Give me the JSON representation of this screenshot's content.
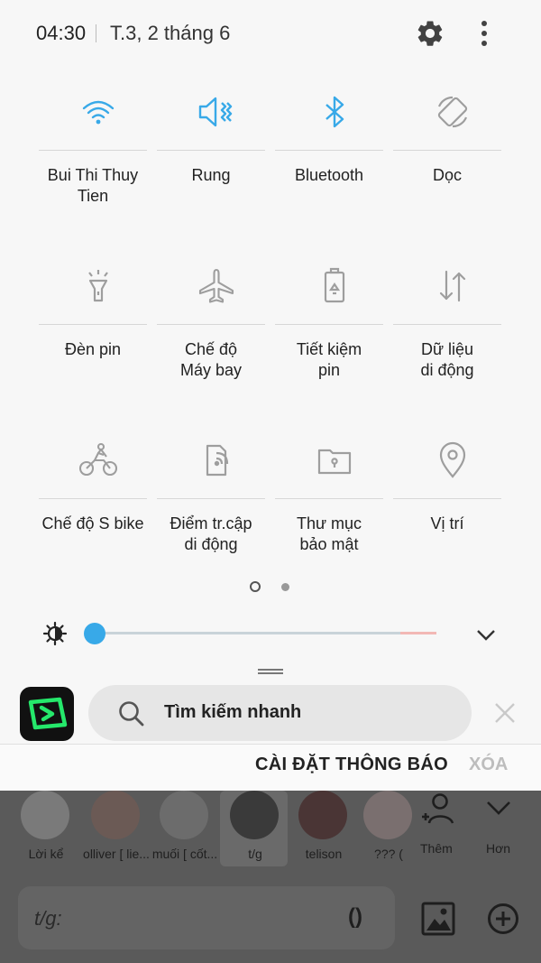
{
  "status": {
    "time": "04:30",
    "date": "T.3, 2 tháng 6"
  },
  "tiles": [
    {
      "label": "Bui Thi Thuy\nTien",
      "icon": "wifi-icon",
      "active": true
    },
    {
      "label": "Rung",
      "icon": "vibrate-icon",
      "active": true
    },
    {
      "label": "Bluetooth",
      "icon": "bluetooth-icon",
      "active": true
    },
    {
      "label": "Dọc",
      "icon": "rotate-icon",
      "active": false
    },
    {
      "label": "Đèn pin",
      "icon": "flashlight-icon",
      "active": false
    },
    {
      "label": "Chế độ\nMáy bay",
      "icon": "airplane-icon",
      "active": false
    },
    {
      "label": "Tiết kiệm\npin",
      "icon": "battery-saver-icon",
      "active": false
    },
    {
      "label": "Dữ liệu\ndi động",
      "icon": "mobile-data-icon",
      "active": false
    },
    {
      "label": "Chế độ S bike",
      "icon": "bike-icon",
      "active": false
    },
    {
      "label": "Điểm tr.cập\ndi động",
      "icon": "hotspot-icon",
      "active": false
    },
    {
      "label": "Thư mục\nbảo mật",
      "icon": "secure-folder-icon",
      "active": false
    },
    {
      "label": "Vị trí",
      "icon": "location-icon",
      "active": false
    }
  ],
  "brightness": {
    "level": 0.0
  },
  "search": {
    "placeholder": "Tìm kiếm nhanh"
  },
  "notifications": {
    "settings_label": "CÀI ĐẶT THÔNG BÁO",
    "clear_label": "XÓA"
  },
  "chat": {
    "contacts": [
      {
        "name": "Lời kể"
      },
      {
        "name": "olliver [ lie..."
      },
      {
        "name": "muối [ cốt..."
      },
      {
        "name": "t/g"
      },
      {
        "name": "telison"
      },
      {
        "name": "??? ("
      }
    ],
    "add_label": "Thêm",
    "more_label": "Hơn",
    "input_text": "t/g:",
    "paren": "()"
  },
  "colors": {
    "accent": "#38a9e8",
    "inactive_icon": "#9e9e9e",
    "panel_bg": "#f7f7f7"
  }
}
